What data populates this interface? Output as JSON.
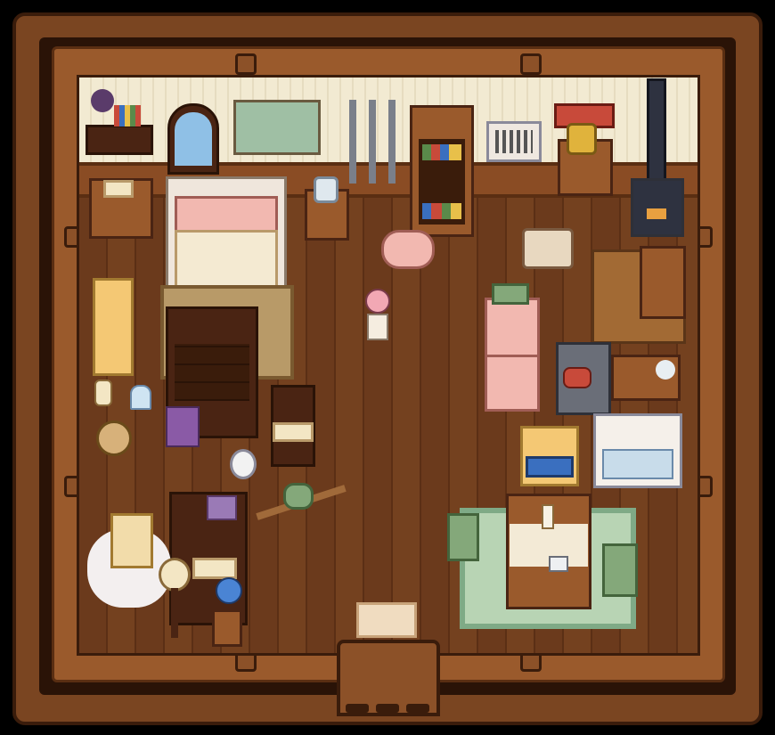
{
  "scene": {
    "description_name": "cozy-pixel-cottage-interior"
  },
  "colors": {
    "frame": "#7a4521",
    "floor": "#6b3a1c",
    "wall": "#f2ead2",
    "rug_green": "#b8d4b4",
    "fridge": "#f2b8b0"
  }
}
